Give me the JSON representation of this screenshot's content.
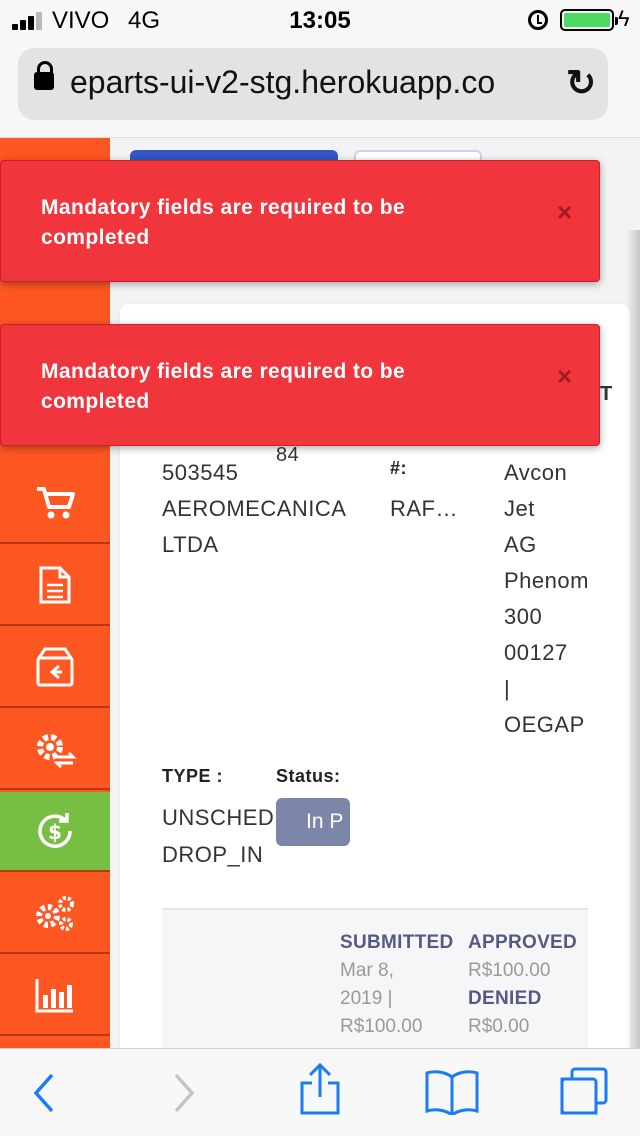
{
  "status_bar": {
    "carrier": "VIVO",
    "network": "4G",
    "time": "13:05",
    "icons": [
      "signal-icon",
      "alarm-icon",
      "battery-icon",
      "charging-icon"
    ]
  },
  "browser": {
    "url": "eparts-ui-v2-stg.herokuapp.co",
    "icons": [
      "lock-icon",
      "reload-icon"
    ]
  },
  "toasts": [
    {
      "message": "Mandatory fields are required to be completed",
      "close": "×"
    },
    {
      "message": "Mandatory fields are required to be completed",
      "close": "×"
    }
  ],
  "sidebar": {
    "items": [
      {
        "icon": "cart-icon",
        "active": false
      },
      {
        "icon": "document-icon",
        "active": false
      },
      {
        "icon": "return-box-icon",
        "active": false
      },
      {
        "icon": "gear-exchange-icon",
        "active": false
      },
      {
        "icon": "dollar-refresh-icon",
        "active": true
      },
      {
        "icon": "gears-icon",
        "active": false
      },
      {
        "icon": "bar-chart-icon",
        "active": false
      }
    ],
    "colors": {
      "base": "#fe5722",
      "active": "#76bf42"
    }
  },
  "card": {
    "partial_number": "84",
    "customer_lines": [
      "503545",
      "AEROMECANICA",
      "LTDA"
    ],
    "col2_label": "#:",
    "col2_value": "RAF…",
    "col3_partial_label": "T",
    "aircraft_lines": [
      "Avcon",
      "Jet",
      "AG",
      "Phenom",
      "300",
      "00127",
      "|",
      "OEGAP"
    ],
    "type_label": "TYPE :",
    "type_lines": [
      "UNSCHED",
      "DROP_IN"
    ],
    "status_label": "Status:",
    "status_value": "In P"
  },
  "summary": {
    "submitted_label": "SUBMITTED",
    "submitted_lines": [
      "Mar 8,",
      "2019 |",
      "R$100.00"
    ],
    "approved_label": "APPROVED",
    "approved_value": "R$100.00",
    "denied_label": "DENIED",
    "denied_value": "R$0.00"
  },
  "toolbar": {
    "icons": [
      "back-icon",
      "forward-icon",
      "share-icon",
      "bookmarks-icon",
      "tabs-icon"
    ],
    "accent": "#1a7cf5"
  }
}
